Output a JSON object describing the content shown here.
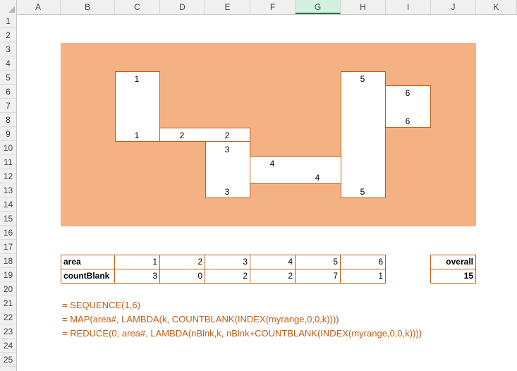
{
  "columns": [
    "A",
    "B",
    "C",
    "D",
    "E",
    "F",
    "G",
    "H",
    "I",
    "J",
    "K"
  ],
  "selected_column": "G",
  "rows": [
    "1",
    "2",
    "3",
    "4",
    "5",
    "6",
    "7",
    "8",
    "9",
    "10",
    "11",
    "12",
    "13",
    "14",
    "15",
    "16",
    "17",
    "18",
    "19",
    "20",
    "21",
    "22",
    "23",
    "24",
    "25"
  ],
  "colors": {
    "fill": "#f4b183",
    "border": "#c55a11",
    "formula_text": "#c55a11"
  },
  "diagram": {
    "labels": {
      "b1_top": "1",
      "b1_bot": "1",
      "b2_left": "2",
      "b2_right": "2",
      "b3_top": "3",
      "b3_bot": "3",
      "b4_left": "4",
      "b4_right": "4",
      "b5_top": "5",
      "b5_bot": "5",
      "b6_top": "6",
      "b6_bot": "6"
    }
  },
  "table": {
    "area_label": "area",
    "area_values": [
      "1",
      "2",
      "3",
      "4",
      "5",
      "6"
    ],
    "count_label": "countBlank",
    "count_values": [
      "3",
      "0",
      "2",
      "2",
      "7",
      "1"
    ]
  },
  "overall": {
    "label": "overall",
    "value": "15"
  },
  "formulas": [
    "= SEQUENCE(1,6)",
    "= MAP(area#, LAMBDA(k, COUNTBLANK(INDEX(myrange,0,0,k))))",
    "= REDUCE(0, area#, LAMBDA(nBlnk,k, nBlnk+COUNTBLANK(INDEX(myrange,0,0,k))))"
  ]
}
